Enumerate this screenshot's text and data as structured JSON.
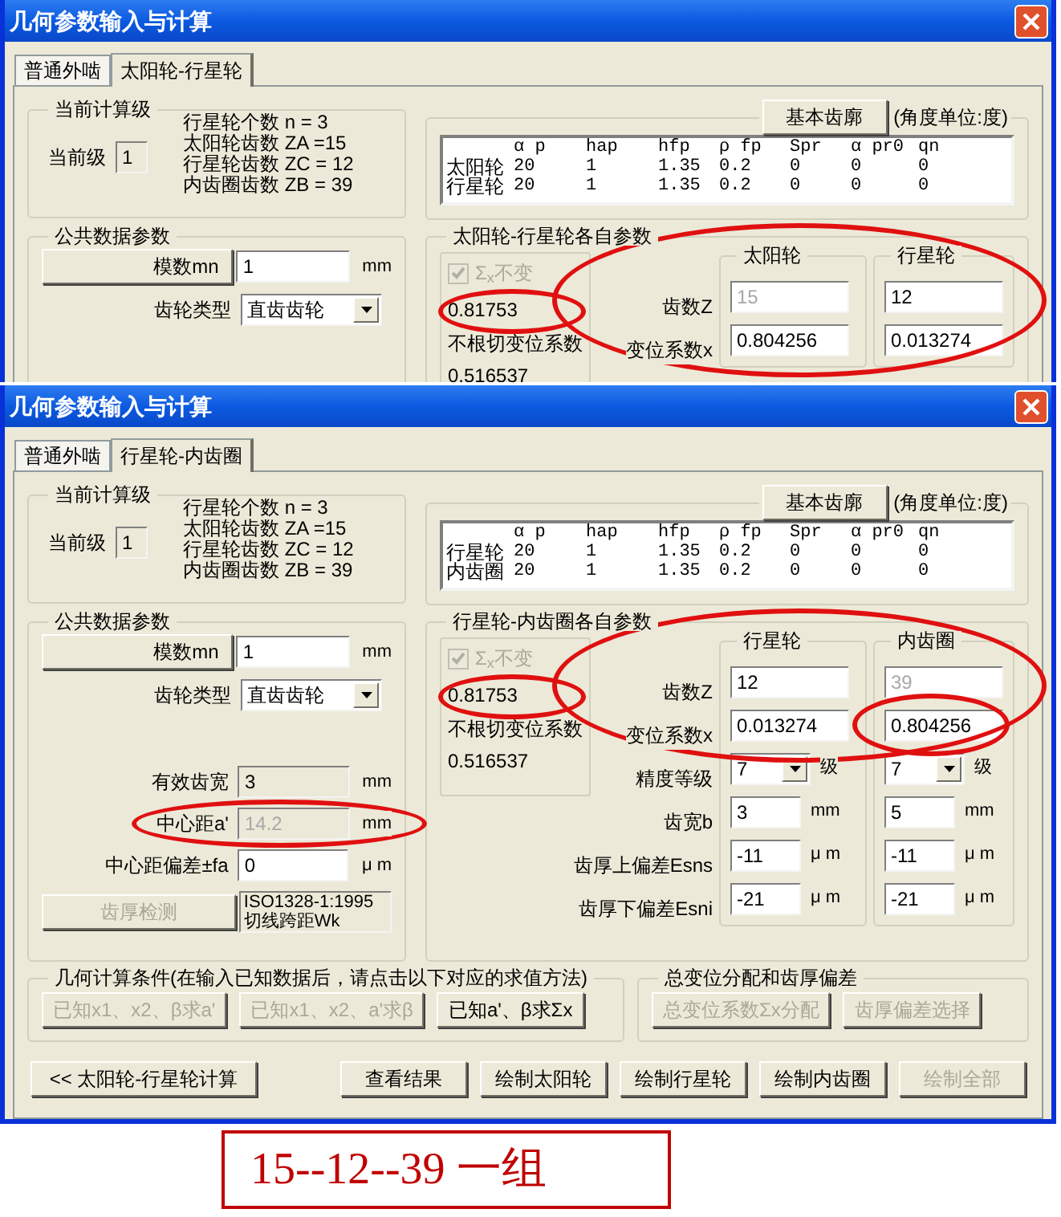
{
  "windows": [
    {
      "title": "几何参数输入与计算",
      "tabs": [
        {
          "label": "普通外啮",
          "selected": false
        },
        {
          "label": "太阳轮-行星轮",
          "selected": true
        }
      ],
      "stage": {
        "title": "当前计算级",
        "label": "当前级",
        "value": "1",
        "info": [
          "行星轮个数 n = 3",
          "太阳轮齿数 ZA =15",
          "行星轮齿数 ZC = 12",
          "内齿圈齿数 ZB = 39"
        ]
      },
      "profile": {
        "button": "基本齿廓",
        "unit_note": "(角度单位:度)",
        "columns": [
          "α p",
          "hap",
          "hfp",
          "ρ fp",
          "Spr",
          "α pr0",
          "qn"
        ],
        "rows": [
          {
            "name": "太阳轮",
            "values": [
              "20",
              "1",
              "1.35",
              "0.2",
              "0",
              "0",
              "0"
            ]
          },
          {
            "name": "行星轮",
            "values": [
              "20",
              "1",
              "1.35",
              "0.2",
              "0",
              "0",
              "0"
            ]
          }
        ]
      },
      "common": {
        "title": "公共数据参数",
        "rows": [
          {
            "kind": "button-input",
            "label": "模数mn",
            "value": "1",
            "unit": "mm",
            "disabled": false,
            "readonly": false,
            "circled": false
          },
          {
            "kind": "select",
            "label": "齿轮类型",
            "value": "直齿齿轮",
            "disabled": false,
            "readonly": false,
            "circled": false
          }
        ]
      },
      "own": {
        "title": "太阳轮-行星轮各自参数",
        "sum_lock": {
          "label": "Σ$_{x}$不变",
          "checked": true,
          "disabled": true
        },
        "sum_value": "0.81753",
        "sum_circled": true,
        "nonundercut_label": "不根切变位系数",
        "nonundercut_value": "0.516537",
        "circled": true,
        "rows": [
          {
            "label": "齿数Z",
            "kind": "input"
          },
          {
            "label": "变位系数x",
            "kind": "input"
          }
        ],
        "gears": [
          {
            "title": "太阳轮",
            "cells": [
              {
                "value": "15",
                "disabled": true,
                "circled": false
              },
              {
                "value": "0.804256",
                "disabled": false,
                "circled": false
              }
            ]
          },
          {
            "title": "行星轮",
            "cells": [
              {
                "value": "12",
                "disabled": false,
                "circled": false
              },
              {
                "value": "0.013274",
                "disabled": false,
                "circled": false
              }
            ]
          }
        ]
      }
    },
    {
      "title": "几何参数输入与计算",
      "tabs": [
        {
          "label": "普通外啮",
          "selected": false
        },
        {
          "label": "行星轮-内齿圈",
          "selected": true
        }
      ],
      "stage": {
        "title": "当前计算级",
        "label": "当前级",
        "value": "1",
        "info": [
          "行星轮个数 n = 3",
          "太阳轮齿数 ZA =15",
          "行星轮齿数 ZC = 12",
          "内齿圈齿数 ZB = 39"
        ]
      },
      "profile": {
        "button": "基本齿廓",
        "unit_note": "(角度单位:度)",
        "columns": [
          "α p",
          "hap",
          "hfp",
          "ρ fp",
          "Spr",
          "α pr0",
          "qn"
        ],
        "rows": [
          {
            "name": "行星轮",
            "values": [
              "20",
              "1",
              "1.35",
              "0.2",
              "0",
              "0",
              "0"
            ]
          },
          {
            "name": "内齿圈",
            "values": [
              "20",
              "1",
              "1.35",
              "0.2",
              "0",
              "0",
              "0"
            ]
          }
        ]
      },
      "common": {
        "title": "公共数据参数",
        "rows": [
          {
            "kind": "button-input",
            "label": "模数mn",
            "value": "1",
            "unit": "mm",
            "disabled": false,
            "readonly": false,
            "circled": false
          },
          {
            "kind": "select",
            "label": "齿轮类型",
            "value": "直齿齿轮",
            "disabled": false,
            "readonly": false,
            "circled": false
          },
          {
            "kind": "input",
            "label": "有效齿宽",
            "value": "3",
            "unit": "mm",
            "disabled": false,
            "readonly": true,
            "circled": false
          },
          {
            "kind": "input",
            "label": "中心距a'",
            "value": "14.2",
            "unit": "mm",
            "disabled": true,
            "readonly": true,
            "circled": true
          },
          {
            "kind": "input",
            "label": "中心距偏差±fa",
            "value": "0",
            "unit": "μ m",
            "disabled": false,
            "readonly": false,
            "circled": false
          },
          {
            "kind": "button-note",
            "label": "齿厚检测",
            "note": [
              "ISO1328-1:1995",
              "切线跨距Wk"
            ],
            "disabled": true,
            "readonly": true,
            "circled": false
          }
        ]
      },
      "own": {
        "title": "行星轮-内齿圈各自参数",
        "sum_lock": {
          "label": "Σ$_{x}$不变",
          "checked": true,
          "disabled": true
        },
        "sum_value": "0.81753",
        "sum_circled": true,
        "nonundercut_label": "不根切变位系数",
        "nonundercut_value": "0.516537",
        "circled": true,
        "rows": [
          {
            "label": "齿数Z",
            "kind": "input"
          },
          {
            "label": "变位系数x",
            "kind": "input"
          },
          {
            "label": "精度等级",
            "kind": "select"
          },
          {
            "label": "齿宽b",
            "kind": "input"
          },
          {
            "label": "齿厚上偏差Esns",
            "kind": "input"
          },
          {
            "label": "齿厚下偏差Esni",
            "kind": "input"
          }
        ],
        "gears": [
          {
            "title": "行星轮",
            "cells": [
              {
                "value": "12",
                "disabled": false,
                "circled": false
              },
              {
                "value": "0.013274",
                "disabled": false,
                "circled": false
              },
              {
                "value": "7",
                "unit": "级",
                "disabled": false,
                "circled": false
              },
              {
                "value": "3",
                "unit": "mm",
                "disabled": false,
                "circled": false
              },
              {
                "value": "-11",
                "unit": "μ m",
                "disabled": false,
                "circled": false
              },
              {
                "value": "-21",
                "unit": "μ m",
                "disabled": false,
                "circled": false
              }
            ]
          },
          {
            "title": "内齿圈",
            "cells": [
              {
                "value": "39",
                "disabled": true,
                "circled": false
              },
              {
                "value": "0.804256",
                "disabled": false,
                "circled": true
              },
              {
                "value": "7",
                "unit": "级",
                "disabled": false,
                "circled": false
              },
              {
                "value": "5",
                "unit": "mm",
                "disabled": false,
                "circled": false
              },
              {
                "value": "-11",
                "unit": "μ m",
                "disabled": false,
                "circled": false
              },
              {
                "value": "-21",
                "unit": "μ m",
                "disabled": false,
                "circled": false
              }
            ]
          }
        ]
      },
      "conditions": {
        "title": "几何计算条件(在输入已知数据后，请点击以下对应的求值方法)",
        "buttons": [
          {
            "label": "已知x1、x2、β求a'",
            "disabled": true
          },
          {
            "label": "已知x1、x2、a'求β",
            "disabled": true
          },
          {
            "label": "已知a'、β求Σx",
            "disabled": false
          }
        ]
      },
      "distribution": {
        "title": "总变位分配和齿厚偏差",
        "buttons": [
          {
            "label": "总变位系数Σx分配",
            "disabled": true
          },
          {
            "label": "齿厚偏差选择",
            "disabled": true
          }
        ]
      },
      "footer": [
        {
          "label": "<< 太阳轮-行星轮计算",
          "disabled": false
        },
        {
          "label": "查看结果",
          "disabled": false
        },
        {
          "label": "绘制太阳轮",
          "disabled": false
        },
        {
          "label": "绘制行星轮",
          "disabled": false
        },
        {
          "label": "绘制内齿圈",
          "disabled": false
        },
        {
          "label": "绘制全部",
          "disabled": true
        }
      ]
    }
  ],
  "caption": "15--12--39 一组"
}
